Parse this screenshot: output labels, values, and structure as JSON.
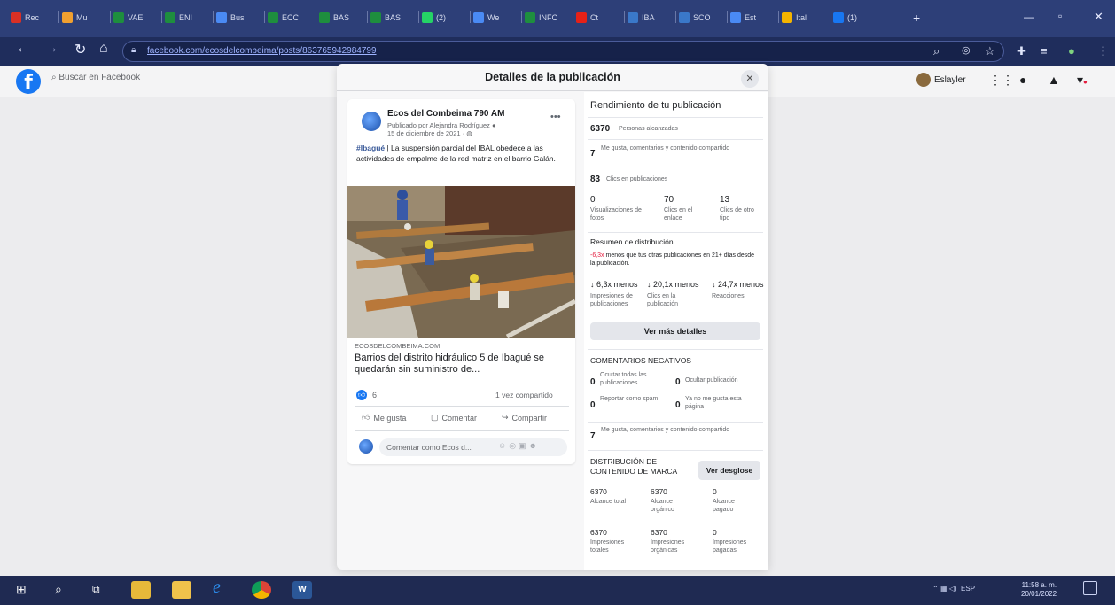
{
  "browser": {
    "tabs": [
      {
        "label": "Rec",
        "icon": "gmail-icon",
        "color": "#d93025"
      },
      {
        "label": "Mu",
        "icon": "github-icon",
        "color": "#f0a030"
      },
      {
        "label": "VAE",
        "icon": "sheets-icon",
        "color": "#1e8e3e"
      },
      {
        "label": "ENI",
        "icon": "sheets-icon",
        "color": "#1e8e3e"
      },
      {
        "label": "Bus",
        "icon": "globe-icon",
        "color": "#4a8af4"
      },
      {
        "label": "ECC",
        "icon": "sheets-icon",
        "color": "#1e8e3e"
      },
      {
        "label": "BAS",
        "icon": "sheets-icon",
        "color": "#1e8e3e"
      },
      {
        "label": "BAS",
        "icon": "sheets-icon",
        "color": "#1e8e3e"
      },
      {
        "label": "(2)",
        "icon": "whatsapp-icon",
        "color": "#25d366"
      },
      {
        "label": "We",
        "icon": "globe-icon",
        "color": "#4a8af4"
      },
      {
        "label": "INFC",
        "icon": "sheets-icon",
        "color": "#1e8e3e"
      },
      {
        "label": "Ct",
        "icon": "youtube-icon",
        "color": "#e62117"
      },
      {
        "label": "IBA",
        "icon": "ibal-icon",
        "color": "#3a78c9"
      },
      {
        "label": "SCO",
        "icon": "ibal-icon",
        "color": "#3a78c9"
      },
      {
        "label": "Est",
        "icon": "globe-icon",
        "color": "#4a8af4"
      },
      {
        "label": "Ital",
        "icon": "maps-icon",
        "color": "#f4b400"
      },
      {
        "label": "(1)",
        "icon": "facebook-icon",
        "color": "#1877f2"
      }
    ],
    "url": "facebook.com/ecosdelcombeima/posts/863765942984799"
  },
  "fb_header": {
    "search_placeholder": "Buscar en Facebook",
    "profile_name": "Eslayler"
  },
  "modal": {
    "title": "Detalles de la publicación",
    "close_icon": "close-icon"
  },
  "post": {
    "page_name": "Ecos del Combeima 790 AM",
    "published_by": "Publicado por Alejandra Rodríguez",
    "date": "15 de diciembre de 2021",
    "hashtag": "#Ibagué",
    "text": " | La suspensión parcial del IBAL obedece a las actividades de empalme de la red matriz en el barrio Galán.",
    "link_domain": "ECOSDELCOMBEIMA.COM",
    "link_title": "Barrios del distrito hidráulico 5 de Ibagué se quedarán sin suministro de...",
    "reaction_count": "6",
    "share_count": "1 vez compartido",
    "actions": {
      "like": "Me gusta",
      "comment": "Comentar",
      "share": "Compartir"
    },
    "comment_placeholder": "Comentar como Ecos d..."
  },
  "performance": {
    "title": "Rendimiento de tu publicación",
    "reach": {
      "value": "6370",
      "label": "Personas alcanzadas"
    },
    "engagement": {
      "value": "7",
      "label": "Me gusta, comentarios y contenido compartido"
    },
    "clicks": {
      "value": "83",
      "label": "Clics en publicaciones"
    },
    "click_breakdown": [
      {
        "value": "0",
        "label": "Visualizaciones de fotos"
      },
      {
        "value": "70",
        "label": "Clics en el enlace"
      },
      {
        "value": "13",
        "label": "Clics de otro tipo"
      }
    ],
    "distribution_title": "Resumen de distribución",
    "distribution_note_strong": "-6,3x",
    "distribution_note": " menos que tus otras publicaciones en 21+ días desde la publicación.",
    "distribution_stats": [
      {
        "value": "↓ 6,3x menos",
        "label": "Impresiones de publicaciones"
      },
      {
        "value": "↓ 20,1x menos",
        "label": "Clics en la publicación"
      },
      {
        "value": "↓ 24,7x menos",
        "label": "Reacciones"
      }
    ],
    "see_more": "Ver más detalles",
    "negative_title": "COMENTARIOS NEGATIVOS",
    "negative": [
      {
        "value": "0",
        "label": "Ocultar todas las publicaciones"
      },
      {
        "value": "0",
        "label": "Ocultar publicación"
      },
      {
        "value": "0",
        "label": "Reportar como spam"
      },
      {
        "value": "0",
        "label": "Ya no me gusta esta página"
      }
    ],
    "engagement2": {
      "value": "7",
      "label": "Me gusta, comentarios y contenido compartido"
    },
    "brand_title": "DISTRIBUCIÓN DE CONTENIDO DE MARCA",
    "breakdown_button": "Ver desglose",
    "brand_stats": [
      {
        "value": "6370",
        "label": "Alcance total"
      },
      {
        "value": "6370",
        "label": "Alcance orgánico"
      },
      {
        "value": "0",
        "label": "Alcance pagado"
      },
      {
        "value": "6370",
        "label": "Impresiones totales"
      },
      {
        "value": "6370",
        "label": "Impresiones orgánicas"
      },
      {
        "value": "0",
        "label": "Impresiones pagadas"
      }
    ]
  },
  "taskbar": {
    "tray": "ESP",
    "time": "11:58 a. m.",
    "date": "20/01/2022"
  }
}
